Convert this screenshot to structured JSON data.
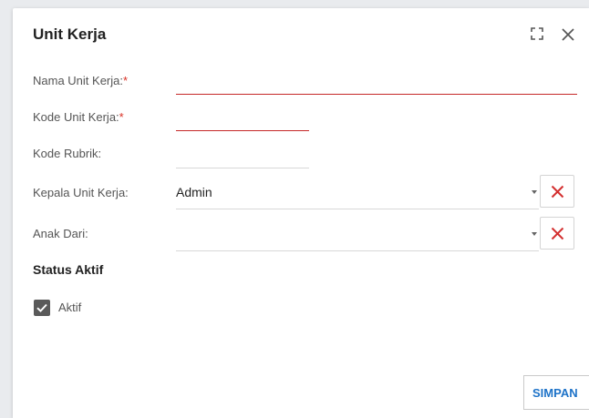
{
  "dialog": {
    "title": "Unit Kerja",
    "icons": {
      "maximize": "maximize-icon",
      "close": "close-icon"
    }
  },
  "form": {
    "nama_unit_kerja": {
      "label": "Nama Unit Kerja:",
      "required_mark": "*",
      "value": ""
    },
    "kode_unit_kerja": {
      "label": "Kode Unit Kerja:",
      "required_mark": "*",
      "value": ""
    },
    "kode_rubrik": {
      "label": "Kode Rubrik:",
      "value": ""
    },
    "kepala_unit_kerja": {
      "label": "Kepala Unit Kerja:",
      "value": "Admin"
    },
    "anak_dari": {
      "label": "Anak Dari:",
      "value": ""
    }
  },
  "status": {
    "heading": "Status Aktif",
    "checkbox_label": "Aktif",
    "checked": true
  },
  "actions": {
    "save_label": "SIMPAN"
  },
  "colors": {
    "required": "#d93025",
    "invalid_underline": "#c62828",
    "clear_icon": "#d32f2f",
    "save_text": "#1e73c8",
    "checkbox": "#5a5a5a"
  }
}
